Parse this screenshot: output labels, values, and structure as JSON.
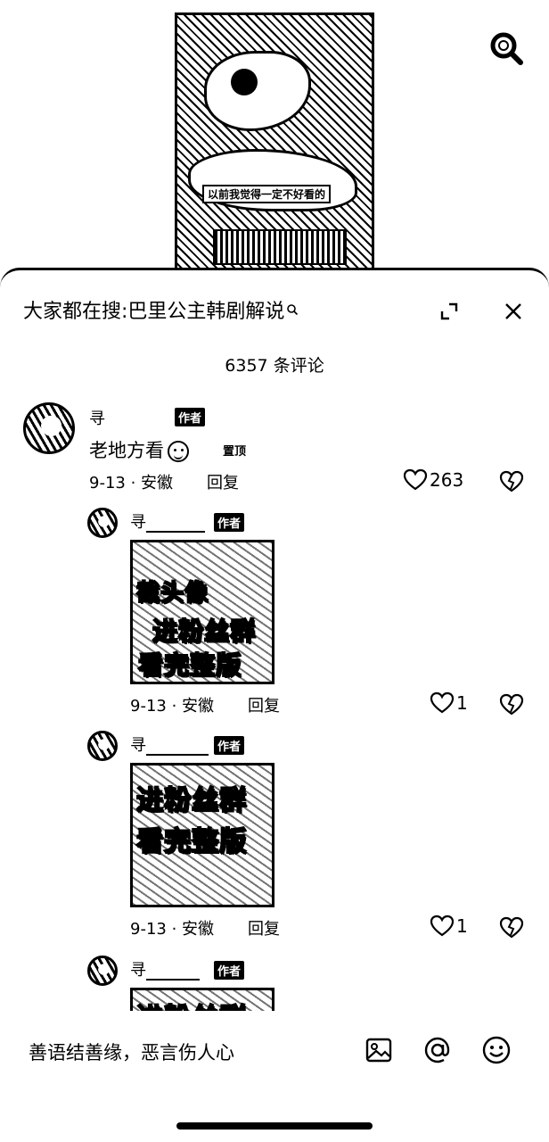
{
  "video": {
    "caption": "以前我觉得一定不好看的"
  },
  "sheet": {
    "suggest_prefix": "大家都在搜:",
    "suggest_query": "巴里公主韩剧解说",
    "comment_count": "6357 条评论"
  },
  "comments": [
    {
      "username": "寻",
      "tag": "作者",
      "text": "老地方看",
      "pinned": "置顶",
      "date_loc": "9-13 · 安徽",
      "reply": "回复",
      "likes": "263"
    },
    {
      "username": "寻",
      "tag": "作者",
      "image_text": [
        "截头像",
        "进粉丝群",
        "看完整版"
      ],
      "date_loc": "9-13 · 安徽",
      "reply": "回复",
      "likes": "1"
    },
    {
      "username": "寻",
      "tag": "作者",
      "image_text": [
        "进粉丝群",
        "看完整版"
      ],
      "date_loc": "9-13 · 安徽",
      "reply": "回复",
      "likes": "1"
    },
    {
      "username": "寻",
      "tag": "作者",
      "image_text": [
        "进粉丝群"
      ]
    }
  ],
  "input": {
    "placeholder": "善语结善缘，恶言伤人心"
  },
  "icons": {
    "search": "search-icon",
    "expand": "expand-icon",
    "close": "close-icon",
    "heart": "heart-icon",
    "broken_heart": "broken-heart-icon",
    "image": "image-icon",
    "mention": "at-icon",
    "emoji": "emoji-icon"
  }
}
